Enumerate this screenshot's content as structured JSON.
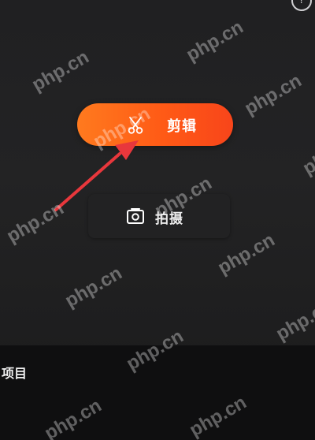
{
  "main": {
    "edit_button_label": "剪辑",
    "shoot_button_label": "拍摄"
  },
  "bottom": {
    "projects_label": "项目"
  },
  "watermark": {
    "text": "php.cn"
  },
  "icons": {
    "edit": "scissors-icon",
    "shoot": "camera-icon",
    "help": "help-icon"
  },
  "colors": {
    "accent_start": "#ff7a1e",
    "accent_end": "#f8451a",
    "arrow": "#e8373c",
    "background": "#202022"
  }
}
